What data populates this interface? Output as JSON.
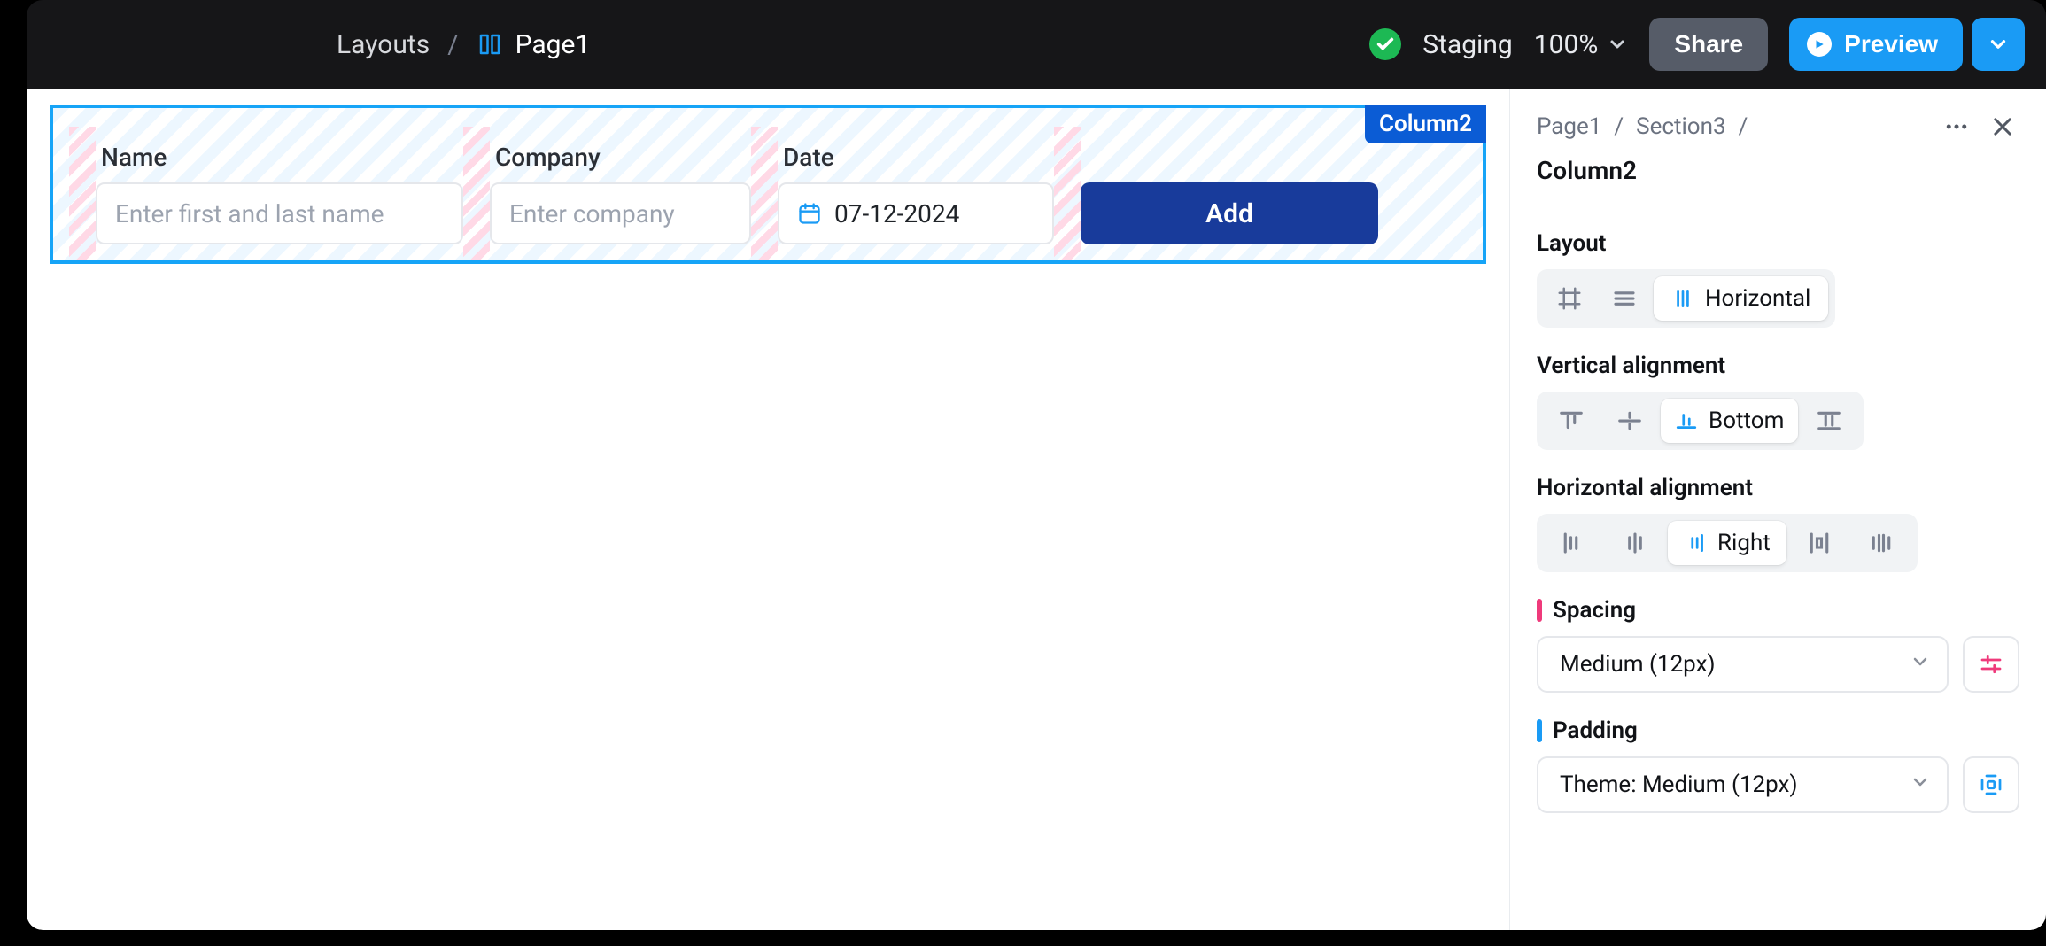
{
  "topbar": {
    "breadcrumbs": {
      "root": "Layouts",
      "page": "Page1"
    },
    "env": "Staging",
    "zoom": "100%",
    "share": "Share",
    "preview": "Preview"
  },
  "canvas": {
    "selection_label": "Column2",
    "form": {
      "name": {
        "label": "Name",
        "placeholder": "Enter first and last name"
      },
      "company": {
        "label": "Company",
        "placeholder": "Enter company"
      },
      "date": {
        "label": "Date",
        "value": "07-12-2024"
      },
      "add_label": "Add"
    }
  },
  "panel": {
    "crumbs": [
      "Page1",
      "Section3"
    ],
    "title": "Column2",
    "layout": {
      "heading": "Layout",
      "selected_label": "Horizontal"
    },
    "valign": {
      "heading": "Vertical alignment",
      "selected_label": "Bottom"
    },
    "halign": {
      "heading": "Horizontal alignment",
      "selected_label": "Right"
    },
    "spacing": {
      "heading": "Spacing",
      "value": "Medium (12px)"
    },
    "padding": {
      "heading": "Padding",
      "value": "Theme: Medium (12px)"
    }
  }
}
